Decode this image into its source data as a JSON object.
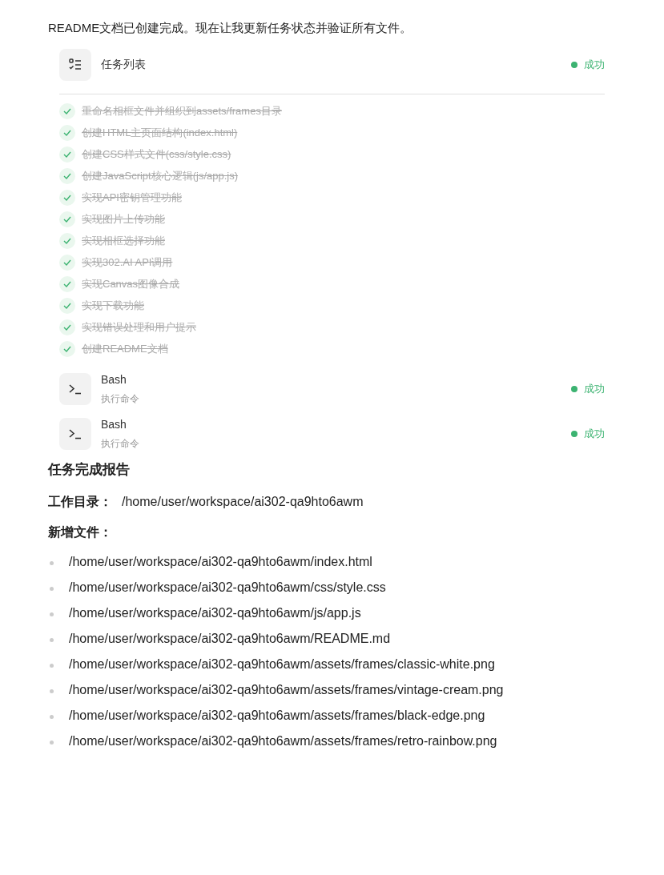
{
  "intro": "README文档已创建完成。现在让我更新任务状态并验证所有文件。",
  "tools": [
    {
      "kind": "todo",
      "title": "任务列表",
      "status": "成功",
      "success": true,
      "tasks": [
        {
          "text": "重命名相框文件并组织到assets/frames目录",
          "done": true
        },
        {
          "text": "创建HTML主页面结构(index.html)",
          "done": true
        },
        {
          "text": "创建CSS样式文件(css/style.css)",
          "done": true
        },
        {
          "text": "创建JavaScript核心逻辑(js/app.js)",
          "done": true
        },
        {
          "text": "实现API密钥管理功能",
          "done": true
        },
        {
          "text": "实现图片上传功能",
          "done": true
        },
        {
          "text": "实现相框选择功能",
          "done": true
        },
        {
          "text": "实现302.AI API调用",
          "done": true
        },
        {
          "text": "实现Canvas图像合成",
          "done": true
        },
        {
          "text": "实现下载功能",
          "done": true
        },
        {
          "text": "实现错误处理和用户提示",
          "done": true
        },
        {
          "text": "创建README文档",
          "done": true
        }
      ]
    },
    {
      "kind": "bash",
      "title": "Bash",
      "subtitle": "执行命令",
      "status": "成功",
      "success": true
    },
    {
      "kind": "bash",
      "title": "Bash",
      "subtitle": "执行命令",
      "status": "成功",
      "success": true
    }
  ],
  "report": {
    "heading": "任务完成报告",
    "workdir_label": "工作目录：",
    "workdir": "/home/user/workspace/ai302-qa9hto6awm",
    "files_label": "新增文件：",
    "files": [
      "/home/user/workspace/ai302-qa9hto6awm/index.html",
      "/home/user/workspace/ai302-qa9hto6awm/css/style.css",
      "/home/user/workspace/ai302-qa9hto6awm/js/app.js",
      "/home/user/workspace/ai302-qa9hto6awm/README.md",
      "/home/user/workspace/ai302-qa9hto6awm/assets/frames/classic-white.png",
      "/home/user/workspace/ai302-qa9hto6awm/assets/frames/vintage-cream.png",
      "/home/user/workspace/ai302-qa9hto6awm/assets/frames/black-edge.png",
      "/home/user/workspace/ai302-qa9hto6awm/assets/frames/retro-rainbow.png"
    ]
  }
}
